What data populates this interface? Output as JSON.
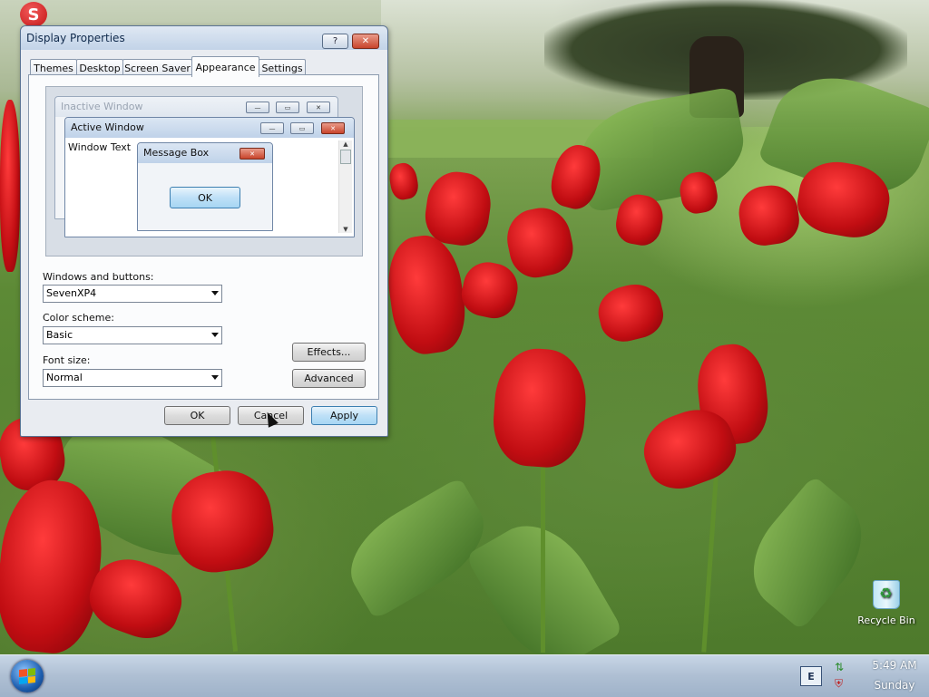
{
  "desktop": {
    "recycle_bin_label": "Recycle Bin",
    "app_icon_letter": "S"
  },
  "dialog": {
    "title": "Display Properties",
    "help_glyph": "?",
    "close_glyph": "✕",
    "tabs": [
      {
        "label": "Themes"
      },
      {
        "label": "Desktop"
      },
      {
        "label": "Screen Saver"
      },
      {
        "label": "Appearance",
        "active": true
      },
      {
        "label": "Settings"
      }
    ],
    "preview": {
      "inactive_window_title": "Inactive Window",
      "active_window_title": "Active Window",
      "window_text": "Window Text",
      "message_box_title": "Message Box",
      "message_box_ok": "OK"
    },
    "windows_and_buttons_label": "Windows and buttons:",
    "windows_and_buttons_value": "SevenXP4",
    "color_scheme_label": "Color scheme:",
    "color_scheme_value": "Basic",
    "font_size_label": "Font size:",
    "font_size_value": "Normal",
    "effects_button": "Effects...",
    "advanced_button": "Advanced",
    "ok_button": "OK",
    "cancel_button": "Cancel",
    "apply_button": "Apply"
  },
  "taskbar": {
    "keyboard_indicator": "E",
    "time": "5:49 AM",
    "day": "Sunday"
  },
  "colors": {
    "active_title": "#c7d8ee",
    "inactive_title": "#e6ecf4",
    "close_red": "#c8442c",
    "default_button": "#bee0f7"
  }
}
